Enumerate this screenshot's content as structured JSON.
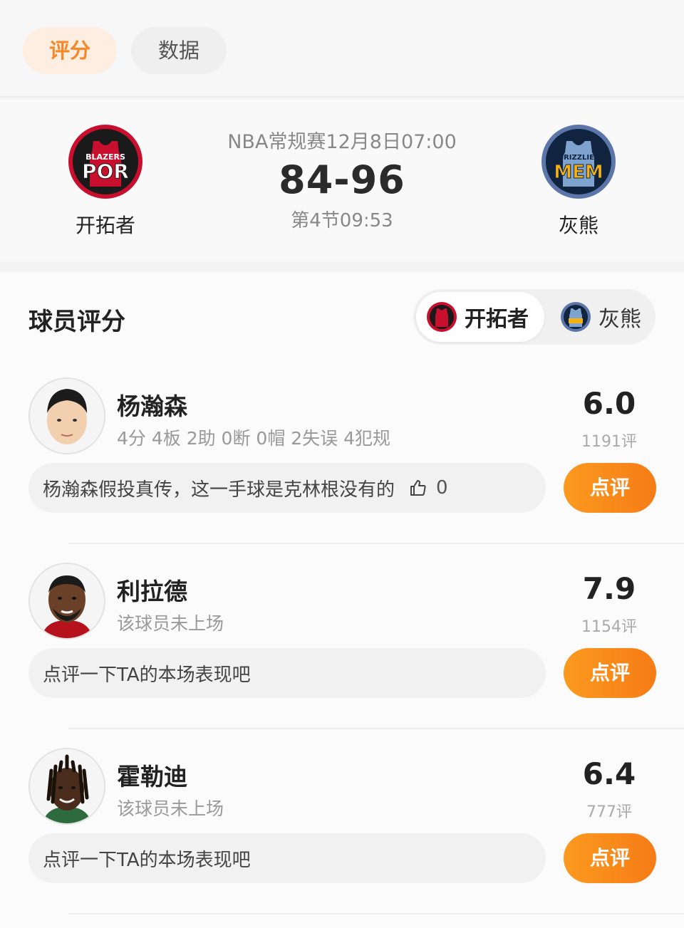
{
  "tabs": [
    {
      "label": "评分",
      "active": true
    },
    {
      "label": "数据",
      "active": false
    }
  ],
  "match": {
    "title": "NBA常规赛12月8日07:00",
    "score": "84-96",
    "status": "第4节09:53",
    "home": {
      "name": "开拓者",
      "logo_text": "POR",
      "logo_sub": "BLAZERS",
      "color": "#c8102e"
    },
    "away": {
      "name": "灰熊",
      "logo_text": "MEM",
      "logo_sub": "GRIZZLIES",
      "color": "#5d76a9"
    }
  },
  "ratings": {
    "title": "球员评分",
    "team_switch": [
      {
        "label": "开拓者",
        "active": true,
        "icon": "blazers-logo-icon"
      },
      {
        "label": "灰熊",
        "active": false,
        "icon": "grizzlies-logo-icon"
      }
    ],
    "players": [
      {
        "name": "杨瀚森",
        "stats": "4分 4板 2助 0断 0帽 2失误 4犯规",
        "score": "6.0",
        "count": "1191评",
        "comment": "杨瀚森假投真传，这一手球是克林根没有的",
        "likes": "0",
        "button": "点评"
      },
      {
        "name": "利拉德",
        "stats": "该球员未上场",
        "score": "7.9",
        "count": "1154评",
        "comment": "点评一下TA的本场表现吧",
        "button": "点评"
      },
      {
        "name": "霍勒迪",
        "stats": "该球员未上场",
        "score": "6.4",
        "count": "777评",
        "comment": "点评一下TA的本场表现吧",
        "button": "点评"
      }
    ]
  },
  "colors": {
    "accent": "#f5892a",
    "button": "#f7861a"
  }
}
